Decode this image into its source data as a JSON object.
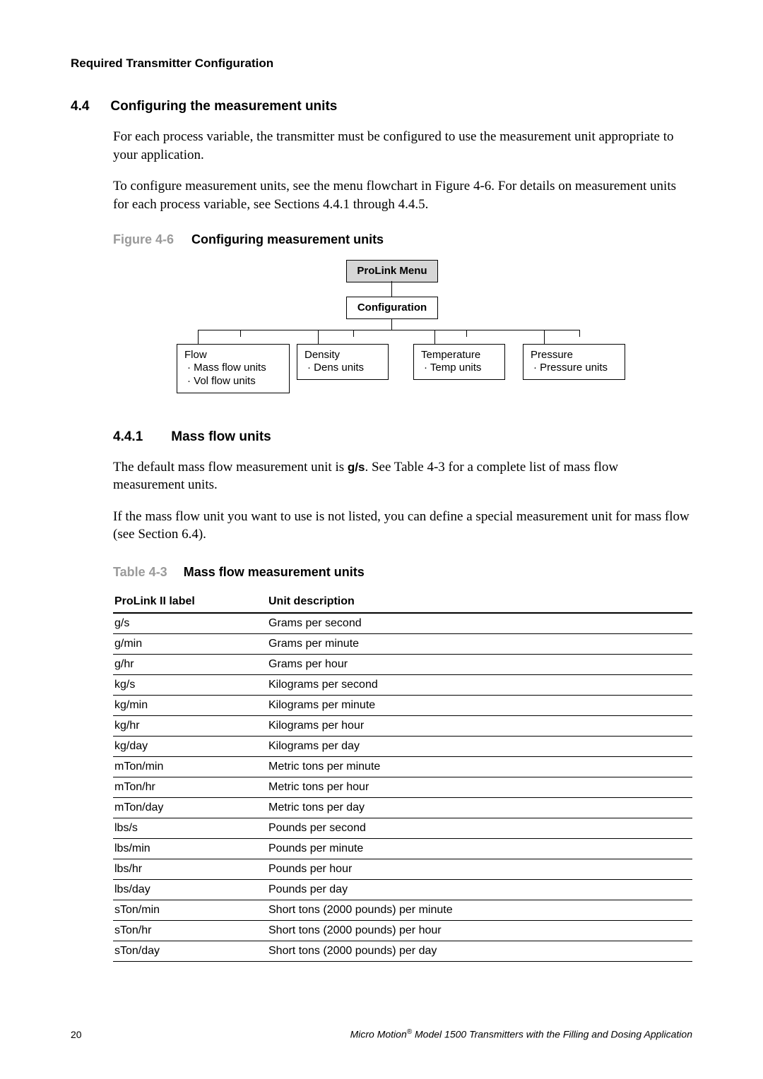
{
  "running_head": "Required Transmitter Configuration",
  "sec44": {
    "num": "4.4",
    "title": "Configuring the measurement units"
  },
  "para1": "For each process variable, the transmitter must be configured to use the measurement unit appropriate to your application.",
  "para2": "To configure measurement units, see the menu flowchart in Figure 4-6. For details on measurement units for each process variable, see Sections 4.4.1 through 4.4.5.",
  "fig46": {
    "label": "Figure 4-6",
    "title": "Configuring measurement units"
  },
  "diagram": {
    "root": "ProLink Menu",
    "cfg": "Configuration",
    "flow": {
      "title": "Flow",
      "items": [
        "· Mass flow units",
        "· Vol flow units"
      ]
    },
    "density": {
      "title": "Density",
      "items": [
        "· Dens units"
      ]
    },
    "temp": {
      "title": "Temperature",
      "items": [
        "· Temp units"
      ]
    },
    "pressure": {
      "title": "Pressure",
      "items": [
        "· Pressure units"
      ]
    }
  },
  "sec441": {
    "num": "4.4.1",
    "title": "Mass flow units"
  },
  "p441_a_pre": "The default mass flow measurement unit is ",
  "p441_a_bold": "g/s",
  "p441_a_post": ". See Table 4-3 for a complete list of mass flow measurement units.",
  "p441_b": "If the mass flow unit you want to use is not listed, you can define a special measurement unit for mass flow (see Section 6.4).",
  "table43": {
    "label": "Table 4-3",
    "title": "Mass flow measurement units",
    "col1": "ProLink II label",
    "col2": "Unit description",
    "rows": [
      {
        "label": "g/s",
        "desc": "Grams per second"
      },
      {
        "label": "g/min",
        "desc": "Grams per minute"
      },
      {
        "label": "g/hr",
        "desc": "Grams per hour"
      },
      {
        "label": "kg/s",
        "desc": "Kilograms per second"
      },
      {
        "label": "kg/min",
        "desc": "Kilograms per minute"
      },
      {
        "label": "kg/hr",
        "desc": "Kilograms per hour"
      },
      {
        "label": "kg/day",
        "desc": "Kilograms per day"
      },
      {
        "label": "mTon/min",
        "desc": "Metric tons per minute"
      },
      {
        "label": "mTon/hr",
        "desc": "Metric tons per hour"
      },
      {
        "label": "mTon/day",
        "desc": "Metric tons per day"
      },
      {
        "label": "lbs/s",
        "desc": "Pounds per second"
      },
      {
        "label": "lbs/min",
        "desc": "Pounds per minute"
      },
      {
        "label": "lbs/hr",
        "desc": "Pounds per hour"
      },
      {
        "label": "lbs/day",
        "desc": "Pounds per day"
      },
      {
        "label": "sTon/min",
        "desc": "Short tons (2000 pounds) per minute"
      },
      {
        "label": "sTon/hr",
        "desc": "Short tons (2000 pounds) per hour"
      },
      {
        "label": "sTon/day",
        "desc": "Short tons (2000 pounds) per day"
      }
    ]
  },
  "footer": {
    "page": "20",
    "title_prefix": "Micro Motion",
    "title_suffix": " Model 1500 Transmitters with the Filling and Dosing Application"
  }
}
